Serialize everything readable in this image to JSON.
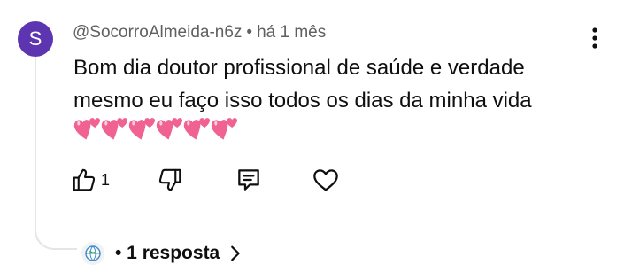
{
  "comment": {
    "avatar_letter": "S",
    "avatar_color": "#5e35b1",
    "author": "@SocorroAlmeida-n6z",
    "separator": "•",
    "time": "há 1 mês",
    "text_line1": "Bom dia doutor profissional de saúde e verdade",
    "text_line2": "mesmo eu faço isso todos os dias da minha vida",
    "emoji": [
      "two-hearts",
      "two-hearts",
      "two-hearts",
      "two-hearts",
      "two-hearts",
      "two-hearts"
    ],
    "more_icon": "more-vertical-icon"
  },
  "actions": {
    "like_icon": "thumb-up-icon",
    "like_count": "1",
    "dislike_icon": "thumb-down-icon",
    "reply_icon": "comment-icon",
    "heart_icon": "heart-icon"
  },
  "replies": {
    "label": "• 1 resposta",
    "chevron_icon": "chevron-right-icon"
  },
  "colors": {
    "text": "#0f0f0f",
    "meta": "#606060",
    "heart_emoji": "#f06292",
    "thread_line": "#e5e5e5"
  }
}
